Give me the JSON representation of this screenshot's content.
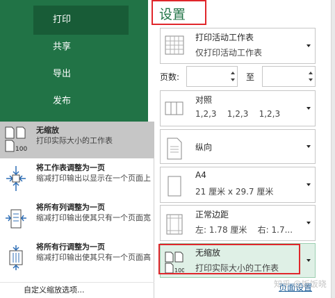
{
  "sidebar": {
    "items": [
      {
        "label": "打印",
        "selected": true
      },
      {
        "label": "共享",
        "selected": false
      },
      {
        "label": "导出",
        "selected": false
      },
      {
        "label": "发布",
        "selected": false
      }
    ]
  },
  "settings": {
    "title": "设置",
    "print_what": {
      "title": "打印活动工作表",
      "subtitle": "仅打印活动工作表"
    },
    "pages": {
      "label": "页数:",
      "to_label": "至",
      "from_value": "",
      "to_value": ""
    },
    "collation": {
      "title": "对照",
      "subtitle": "1,2,3    1,2,3    1,2,3"
    },
    "orientation": {
      "title": "纵向"
    },
    "paper": {
      "title": "A4",
      "subtitle": "21 厘米 x 29.7 厘米"
    },
    "margins": {
      "title": "正常边距",
      "subtitle": "左: 1.78 厘米    右: 1.7..."
    },
    "scaling": {
      "title": "无缩放",
      "subtitle": "打印实际大小的工作表"
    },
    "page_setup_link": "页面设置"
  },
  "scaling_menu": {
    "items": [
      {
        "title": "无缩放",
        "desc": "打印实际大小的工作表",
        "selected": true
      },
      {
        "title": "将工作表调整为一页",
        "desc": "缩减打印输出以显示在一个页面上",
        "selected": false
      },
      {
        "title": "将所有列调整为一页",
        "desc": "缩减打印输出使其只有一个页面宽",
        "selected": false
      },
      {
        "title": "将所有行调整为一页",
        "desc": "缩减打印输出使其只有一个页面高",
        "selected": false
      }
    ],
    "custom_label": "自定义缩放选项..."
  },
  "watermark": "知乎 @饭饭晓",
  "colors": {
    "accent": "#217346",
    "selected": "#185c37",
    "highlight_box": "#e0262b",
    "hover": "#dff0e6"
  },
  "icons": [
    "print-active-sheet-icon",
    "collate-icon",
    "portrait-icon",
    "paper-size-icon",
    "margins-icon",
    "no-scaling-icon",
    "fit-sheet-icon",
    "fit-columns-icon",
    "fit-rows-icon"
  ]
}
